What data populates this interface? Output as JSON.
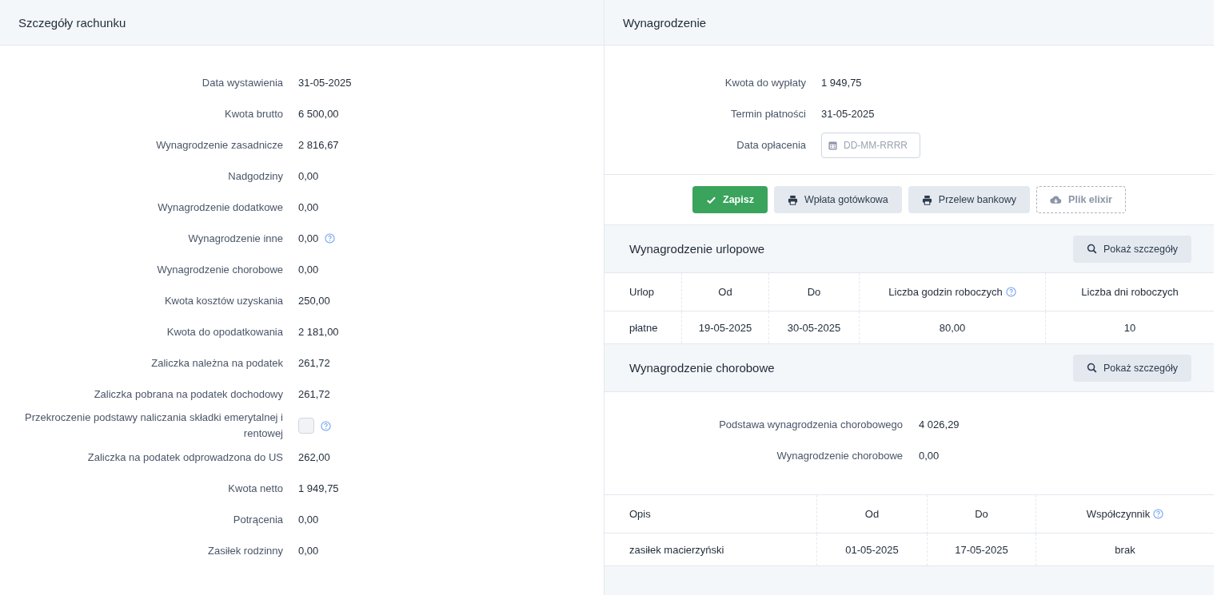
{
  "left": {
    "title": "Szczegóły rachunku",
    "rows": [
      {
        "kind": "value",
        "label": "Data wystawienia",
        "value": "31-05-2025"
      },
      {
        "kind": "value",
        "label": "Kwota brutto",
        "value": "6 500,00"
      },
      {
        "kind": "value",
        "label": "Wynagrodzenie zasadnicze",
        "value": "2 816,67"
      },
      {
        "kind": "value",
        "label": "Nadgodziny",
        "value": "0,00"
      },
      {
        "kind": "value",
        "label": "Wynagrodzenie dodatkowe",
        "value": "0,00"
      },
      {
        "kind": "value",
        "label": "Wynagrodzenie inne",
        "value": "0,00",
        "help": true
      },
      {
        "kind": "value",
        "label": "Wynagrodzenie chorobowe",
        "value": "0,00"
      },
      {
        "kind": "value",
        "label": "Kwota kosztów uzyskania",
        "value": "250,00"
      },
      {
        "kind": "value",
        "label": "Kwota do opodatkowania",
        "value": "2 181,00"
      },
      {
        "kind": "value",
        "label": "Zaliczka należna na podatek",
        "value": "261,72"
      },
      {
        "kind": "value",
        "label": "Zaliczka pobrana na podatek dochodowy",
        "value": "261,72"
      },
      {
        "kind": "checkbox",
        "label": "Przekroczenie podstawy naliczania składki emerytalnej i rentowej",
        "checked": false,
        "help": true
      },
      {
        "kind": "value",
        "label": "Zaliczka na podatek odprowadzona do US",
        "value": "262,00"
      },
      {
        "kind": "value",
        "label": "Kwota netto",
        "value": "1 949,75"
      },
      {
        "kind": "value",
        "label": "Potrącenia",
        "value": "0,00"
      },
      {
        "kind": "value",
        "label": "Zasiłek rodzinny",
        "value": "0,00"
      }
    ]
  },
  "salary": {
    "title": "Wynagrodzenie",
    "rows": [
      {
        "kind": "value",
        "label": "Kwota do wypłaty",
        "value": "1 949,75"
      },
      {
        "kind": "value",
        "label": "Termin płatności",
        "value": "31-05-2025"
      },
      {
        "kind": "date",
        "label": "Data opłacenia",
        "placeholder": "DD-MM-RRRR"
      }
    ],
    "buttons": [
      {
        "kind": "primary",
        "label": "Zapisz"
      },
      {
        "kind": "print",
        "label": "Wpłata gotówkowa"
      },
      {
        "kind": "print",
        "label": "Przelew bankowy"
      },
      {
        "kind": "download",
        "label": "Plik elixir"
      }
    ]
  },
  "vacation": {
    "title": "Wynagrodzenie urlopowe",
    "button": "Pokaż szczegóły",
    "columns": [
      {
        "label": "Urlop"
      },
      {
        "label": "Od"
      },
      {
        "label": "Do"
      },
      {
        "label": "Liczba godzin roboczych",
        "help": true
      },
      {
        "label": "Liczba dni roboczych"
      }
    ],
    "rows": [
      [
        "płatne",
        "19-05-2025",
        "30-05-2025",
        "80,00",
        "10"
      ]
    ]
  },
  "sick": {
    "title": "Wynagrodzenie chorobowe",
    "button": "Pokaż szczegóły",
    "rows": [
      {
        "label": "Podstawa wynagrodzenia chorobowego",
        "value": "4 026,29"
      },
      {
        "label": "Wynagrodzenie chorobowe",
        "value": "0,00"
      }
    ],
    "columns": [
      {
        "label": "Opis"
      },
      {
        "label": "Od"
      },
      {
        "label": "Do"
      },
      {
        "label": "Współczynnik",
        "help": true
      }
    ],
    "table_rows": [
      [
        "zasiłek macierzyński",
        "01-05-2025",
        "17-05-2025",
        "brak"
      ]
    ]
  }
}
